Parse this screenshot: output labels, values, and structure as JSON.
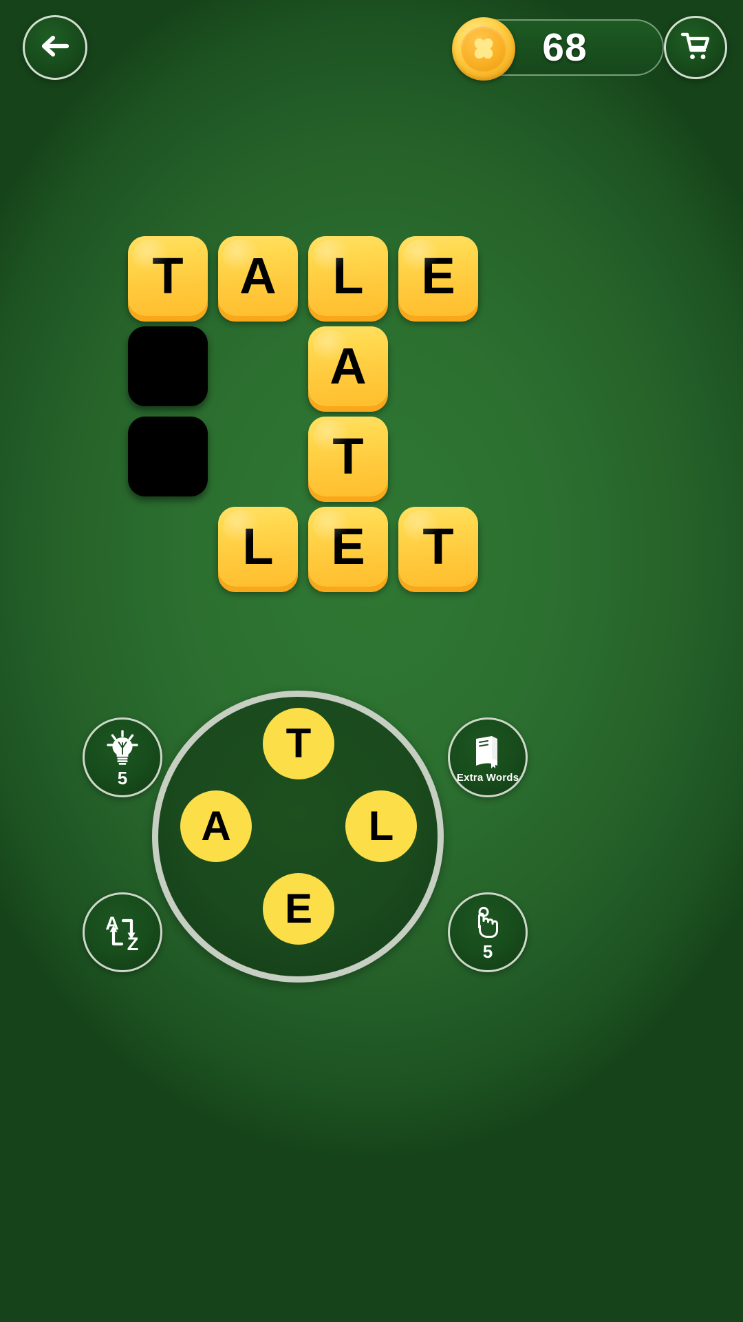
{
  "app": {
    "background_color": "#2c7030",
    "tile_color": "#ffd34a",
    "accent_color": "#fcdf48"
  },
  "topbar": {
    "back_icon": "back-arrow-icon",
    "coin_icon": "clover-coin-icon",
    "coin_count": "68",
    "shop_icon": "shopping-cart-icon"
  },
  "grid": {
    "rows": [
      [
        {
          "letter": "T",
          "state": "filled"
        },
        {
          "letter": "A",
          "state": "filled"
        },
        {
          "letter": "L",
          "state": "filled"
        },
        {
          "letter": "E",
          "state": "filled"
        }
      ],
      [
        {
          "letter": "",
          "state": "blank"
        },
        {
          "letter": "",
          "state": "empty"
        },
        {
          "letter": "A",
          "state": "filled"
        },
        {
          "letter": "",
          "state": "empty"
        }
      ],
      [
        {
          "letter": "",
          "state": "blank"
        },
        {
          "letter": "",
          "state": "empty"
        },
        {
          "letter": "T",
          "state": "filled"
        },
        {
          "letter": "",
          "state": "empty"
        }
      ],
      [
        {
          "letter": "",
          "state": "empty"
        },
        {
          "letter": "L",
          "state": "filled"
        },
        {
          "letter": "E",
          "state": "filled"
        },
        {
          "letter": "T",
          "state": "filled"
        }
      ]
    ]
  },
  "wheel": {
    "letters": [
      {
        "letter": "T",
        "position": "top"
      },
      {
        "letter": "A",
        "position": "left"
      },
      {
        "letter": "L",
        "position": "right"
      },
      {
        "letter": "E",
        "position": "bottom"
      }
    ]
  },
  "actions": {
    "hint": {
      "icon": "lightbulb-icon",
      "count": "5"
    },
    "extra_words": {
      "icon": "book-icon",
      "label": "Extra Words"
    },
    "shuffle": {
      "icon": "a-to-z-shuffle-icon"
    },
    "tap": {
      "icon": "pointing-hand-icon",
      "count": "5"
    }
  }
}
